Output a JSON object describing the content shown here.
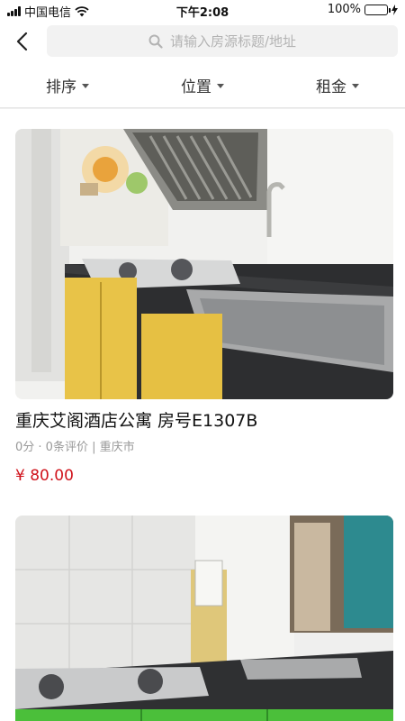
{
  "status_bar": {
    "carrier": "中国电信",
    "time": "下午2:08",
    "battery": "100%"
  },
  "header": {
    "search_placeholder": "请输入房源标题/地址"
  },
  "filters": [
    {
      "label": "排序"
    },
    {
      "label": "位置"
    },
    {
      "label": "租金"
    }
  ],
  "listings": [
    {
      "title": "重庆艾阁酒店公寓 房号E1307B",
      "meta": "0分 · 0条评价 | 重庆市",
      "price": "¥ 80.00"
    }
  ],
  "colors": {
    "price": "#d0121b",
    "battery": "#4cd964"
  }
}
